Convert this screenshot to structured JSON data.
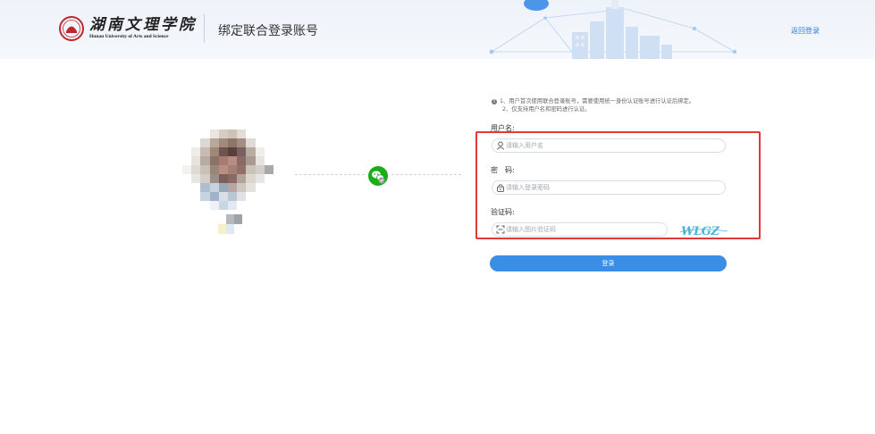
{
  "header": {
    "logo_cn": "湖南文理学院",
    "logo_en": "Hunan University of Arts and Science",
    "page_title": "绑定联合登录账号",
    "return_label": "返回登录"
  },
  "colors": {
    "accent": "#3a8ee6",
    "link": "#2b7de0",
    "wechat": "#1aad19",
    "highlight": "#e53935",
    "seal": "#c0282d"
  },
  "notice": {
    "line1": "1、用户首次使用联合登录账号，需要使用统一身份认证账号进行认证后绑定。",
    "line2": "2、仅支持用户名和密码进行认证。"
  },
  "form": {
    "username": {
      "label": "用户名:",
      "placeholder": "请输入用户名",
      "value": "",
      "icon": "user-icon"
    },
    "password": {
      "label": "密　码:",
      "placeholder": "请输入登录密码",
      "value": "",
      "icon": "lock-icon"
    },
    "captcha": {
      "label": "验证码:",
      "placeholder": "请输入图片验证码",
      "value": "",
      "icon": "scan-icon",
      "image_text": "WLGZ"
    },
    "submit_label": "登录"
  }
}
